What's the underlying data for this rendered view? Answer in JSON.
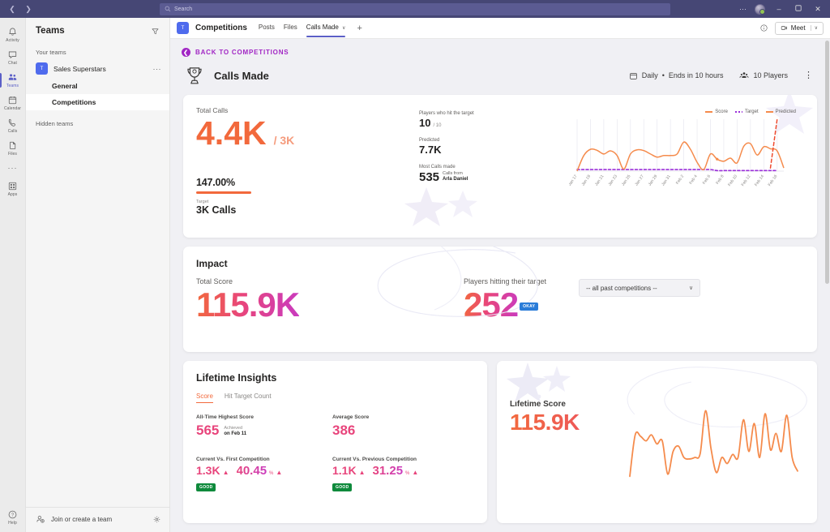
{
  "titlebar": {
    "back_icon": "chevron-left-icon",
    "forward_icon": "chevron-right-icon",
    "search_placeholder": "Search",
    "search_icon": "search-icon",
    "more_icon": "ellipsis-icon",
    "minimize": "–",
    "maximize": "❑",
    "close": "✕"
  },
  "rail": {
    "items": [
      {
        "label": "Activity",
        "icon": "bell-icon",
        "active": false
      },
      {
        "label": "Chat",
        "icon": "chat-icon",
        "active": false
      },
      {
        "label": "Teams",
        "icon": "teams-icon",
        "active": true
      },
      {
        "label": "Calendar",
        "icon": "calendar-icon",
        "active": false
      },
      {
        "label": "Calls",
        "icon": "phone-icon",
        "active": false
      },
      {
        "label": "Files",
        "icon": "file-icon",
        "active": false
      },
      {
        "label": "",
        "icon": "ellipsis-icon",
        "active": false
      },
      {
        "label": "Apps",
        "icon": "apps-grid-icon",
        "active": false
      }
    ],
    "help": {
      "label": "Help",
      "icon": "question-circle-icon"
    }
  },
  "teams_pane": {
    "title": "Teams",
    "filter_icon": "filter-icon",
    "your_teams_label": "Your teams",
    "team": {
      "name": "Sales Superstars",
      "initial": "T",
      "more_icon": "ellipsis-icon"
    },
    "channels": [
      {
        "name": "General",
        "selected": false
      },
      {
        "name": "Competitions",
        "selected": true
      }
    ],
    "hidden_teams_label": "Hidden teams",
    "join_label": "Join or create a team",
    "join_icon": "add-person-icon",
    "settings_icon": "gear-icon"
  },
  "channel_header": {
    "avatar_initial": "T",
    "title": "Competitions",
    "tabs": [
      {
        "label": "Posts",
        "active": false
      },
      {
        "label": "Files",
        "active": false
      },
      {
        "label": "Calls Made",
        "active": true
      }
    ],
    "tab_caret": "∨",
    "add_tab_icon": "plus-icon",
    "info_icon": "info-circle-icon",
    "meet_label": "Meet",
    "meet_icon": "camera-icon",
    "meet_caret": "∨"
  },
  "page": {
    "back_label": "BACK TO COMPETITIONS",
    "back_icon": "arrow-left-circle-icon",
    "trophy_icon": "trophy-icon",
    "title": "Calls Made",
    "meta": {
      "schedule_icon": "calendar-icon",
      "schedule": "Daily",
      "separator": "•",
      "ends": "Ends in 10 hours",
      "players_icon": "people-icon",
      "players": "10 Players",
      "more_icon": "kebab-menu-icon"
    }
  },
  "overview": {
    "total_calls_label": "Total Calls",
    "total_calls_value": "4.4K",
    "total_calls_target": "/ 3K",
    "percent": "147.00%",
    "target_label": "Target",
    "target_value": "3K Calls",
    "hit_target_label": "Players who hit the target",
    "hit_target_value": "10",
    "hit_target_total": "/ 10",
    "predicted_label": "Predicted",
    "predicted_value": "7.7K",
    "most_calls_label": "Most Calls made",
    "most_calls_value": "535",
    "most_calls_sub1": "Calls from",
    "most_calls_sub2": "Arla Daniel"
  },
  "impact": {
    "title": "Impact",
    "total_score_label": "Total Score",
    "total_score_value": "115.9K",
    "players_target_label": "Players hitting their target",
    "players_target_value": "252",
    "players_target_badge": "OKAY",
    "filter_value": "-- all past competitions --",
    "filter_caret": "∨"
  },
  "lifetime_insights": {
    "title": "Lifetime Insights",
    "tabs": [
      {
        "label": "Score",
        "active": true
      },
      {
        "label": "Hit Target Count",
        "active": false
      }
    ],
    "highest_label": "All-Time Highest Score",
    "highest_value": "565",
    "highest_ach_label": "Achieved",
    "highest_ach_date": "on Feb 11",
    "average_label": "Average Score",
    "average_value": "386",
    "vs_first_label": "Current Vs. First Competition",
    "vs_first_value": "1.3K",
    "vs_first_pct": "40.45",
    "vs_first_pct_sym": "%",
    "vs_first_badge": "GOOD",
    "vs_prev_label": "Current Vs. Previous Competition",
    "vs_prev_value": "1.1K",
    "vs_prev_pct": "31.25",
    "vs_prev_pct_sym": "%",
    "vs_prev_badge": "GOOD",
    "up_arrow": "▲"
  },
  "lifetime_score": {
    "label": "Lifetime Score",
    "value": "115.9K"
  },
  "colors": {
    "accent_purple": "#5b5fc7",
    "titlebar": "#464775",
    "orange": "#f2693c",
    "pink": "#e8457c",
    "magenta": "#c93bc0",
    "target_purple": "#9b30d9",
    "badge_blue": "#2a7cd8",
    "badge_green": "#0f8a3c",
    "back_link": "#a126c4"
  },
  "chart_data": [
    {
      "type": "line",
      "title": "",
      "id": "overview-trend",
      "xlabel": "",
      "ylabel": "",
      "grid": true,
      "legend": [
        "Score",
        "Target",
        "Predicted"
      ],
      "legend_position": "top-right",
      "x": [
        "Jan 17",
        "Jan 18",
        "Jan 19",
        "Jan 20",
        "Jan 21",
        "Jan 22",
        "Jan 23",
        "Jan 24",
        "Jan 25",
        "Jan 26",
        "Jan 27",
        "Jan 28",
        "Jan 29",
        "Jan 30",
        "Jan 31",
        "Feb 1",
        "Feb 2",
        "Feb 3",
        "Feb 4",
        "Feb 5",
        "Feb 6",
        "Feb 7",
        "Feb 8",
        "Feb 9",
        "Feb 10",
        "Feb 11",
        "Feb 12",
        "Feb 13",
        "Feb 14",
        "Feb 15",
        "Feb 16"
      ],
      "tick_labels": [
        "Jan 17",
        "Jan 19",
        "Jan 21",
        "Jan 23",
        "Jan 25",
        "Jan 27",
        "Jan 29",
        "Jan 31",
        "Feb 2",
        "Feb 4",
        "Feb 6",
        "Feb 8",
        "Feb 10",
        "Feb 12",
        "Feb 14",
        "Feb 16"
      ],
      "series": [
        {
          "name": "Score",
          "color": "#f58b4c",
          "values": [
            0,
            300,
            420,
            400,
            330,
            390,
            300,
            40,
            330,
            410,
            395,
            330,
            270,
            300,
            300,
            330,
            560,
            420,
            170,
            30,
            330,
            230,
            190,
            250,
            160,
            480,
            530,
            310,
            470,
            430,
            390,
            60
          ]
        },
        {
          "name": "Target",
          "color": "#9b30d9",
          "style": "dashed",
          "values": [
            30,
            30,
            30,
            30,
            30,
            30,
            30,
            30,
            30,
            30,
            30,
            30,
            30,
            30,
            30,
            30,
            30,
            30,
            30,
            30,
            30,
            10,
            10,
            10,
            10,
            10,
            10,
            10,
            10,
            10,
            10
          ]
        },
        {
          "name": "Predicted",
          "color": "#ef4a2e",
          "style": "dashed",
          "values": [
            null,
            null,
            null,
            null,
            null,
            null,
            null,
            null,
            null,
            null,
            null,
            null,
            null,
            null,
            null,
            null,
            null,
            null,
            null,
            null,
            null,
            null,
            null,
            null,
            null,
            null,
            null,
            null,
            null,
            60,
            1000
          ]
        }
      ]
    },
    {
      "type": "line",
      "id": "lifetime-score-sparkline",
      "title": "",
      "legend": [],
      "grid": false,
      "series": [
        {
          "name": "Lifetime Score",
          "color": "#f58b4c",
          "values": [
            5,
            60,
            58,
            52,
            60,
            48,
            52,
            8,
            38,
            45,
            30,
            28,
            30,
            35,
            92,
            42,
            10,
            30,
            22,
            34,
            30,
            80,
            38,
            75,
            30,
            88,
            40,
            62,
            38,
            86,
            30,
            12
          ]
        }
      ]
    }
  ]
}
